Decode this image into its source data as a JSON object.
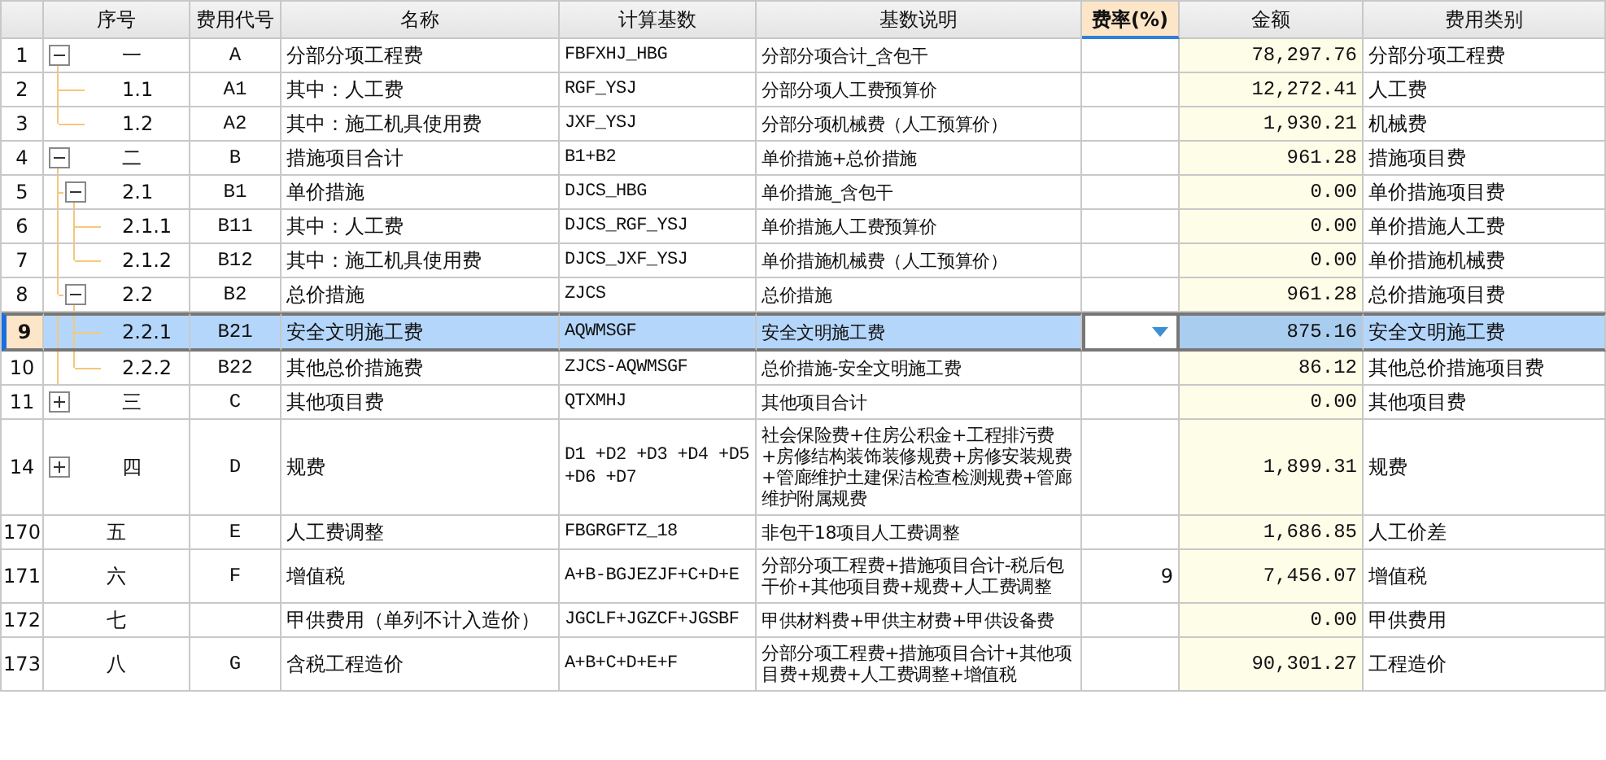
{
  "columns": [
    {
      "label": "序号",
      "kind": "tree",
      "selected": false
    },
    {
      "label": "费用代号",
      "kind": "code",
      "selected": false
    },
    {
      "label": "名称",
      "kind": "text",
      "selected": false
    },
    {
      "label": "计算基数",
      "kind": "formula",
      "selected": false
    },
    {
      "label": "基数说明",
      "kind": "text",
      "selected": false
    },
    {
      "label": "费率(%)",
      "kind": "rate",
      "selected": true
    },
    {
      "label": "金额",
      "kind": "amount",
      "selected": false
    },
    {
      "label": "费用类别",
      "kind": "text",
      "selected": false
    }
  ],
  "rows": [
    {
      "row_num": "1",
      "seq": "一",
      "code": "A",
      "name": "分部分项工程费",
      "base": "FBFXHJ_HBG",
      "base_desc": "分部分项合计_含包干",
      "amount": "78,297.76",
      "category": "分部分项工程费",
      "selected": false,
      "expanded": true,
      "children": [
        {
          "row_num": "2",
          "seq": "1.1",
          "code": "A1",
          "name": "其中：人工费",
          "base": "RGF_YSJ",
          "base_desc": "分部分项人工费预算价",
          "amount": "12,272.41",
          "category": "人工费",
          "selected": false
        },
        {
          "row_num": "3",
          "seq": "1.2",
          "code": "A2",
          "name": "其中：施工机具使用费",
          "base": "JXF_YSJ",
          "base_desc": "分部分项机械费（人工预算价）",
          "amount": "1,930.21",
          "category": "机械费",
          "selected": false
        }
      ]
    },
    {
      "row_num": "4",
      "seq": "二",
      "code": "B",
      "name": "措施项目合计",
      "base": "B1+B2",
      "base_desc": "单价措施+总价措施",
      "amount": "961.28",
      "category": "措施项目费",
      "selected": false,
      "expanded": true,
      "children": [
        {
          "row_num": "5",
          "seq": "2.1",
          "code": "B1",
          "name": "单价措施",
          "base": "DJCS_HBG",
          "base_desc": "单价措施_含包干",
          "amount": "0.00",
          "category": "单价措施项目费",
          "selected": false,
          "expanded": true,
          "children": [
            {
              "row_num": "6",
              "seq": "2.1.1",
              "code": "B11",
              "name": "其中：人工费",
              "base": "DJCS_RGF_YSJ",
              "base_desc": "单价措施人工费预算价",
              "amount": "0.00",
              "category": "单价措施人工费",
              "selected": false
            },
            {
              "row_num": "7",
              "seq": "2.1.2",
              "code": "B12",
              "name": "其中：施工机具使用费",
              "base": "DJCS_JXF_YSJ",
              "base_desc": "单价措施机械费（人工预算价）",
              "amount": "0.00",
              "category": "单价措施机械费",
              "selected": false
            }
          ]
        },
        {
          "row_num": "8",
          "seq": "2.2",
          "code": "B2",
          "name": "总价措施",
          "base": "ZJCS",
          "base_desc": "总价措施",
          "amount": "961.28",
          "category": "总价措施项目费",
          "selected": false,
          "expanded": true,
          "children": [
            {
              "row_num": "9",
              "seq": "2.2.1",
              "code": "B21",
              "name": "安全文明施工费",
              "base": "AQWMSGF",
              "base_desc": "安全文明施工费",
              "amount": "875.16",
              "category": "安全文明施工费",
              "selected": true
            },
            {
              "row_num": "10",
              "seq": "2.2.2",
              "code": "B22",
              "name": "其他总价措施费",
              "base": "ZJCS-AQWMSGF",
              "base_desc": "总价措施-安全文明施工费",
              "amount": "86.12",
              "category": "其他总价措施项目费",
              "selected": false
            }
          ]
        }
      ]
    },
    {
      "row_num": "11",
      "seq": "三",
      "code": "C",
      "name": "其他项目费",
      "base": "QTXMHJ",
      "base_desc": "其他项目合计",
      "amount": "0.00",
      "category": "其他项目费",
      "selected": false,
      "expanded": false
    },
    {
      "row_num": "14",
      "seq": "四",
      "code": "D",
      "name": "规费",
      "base": "D1 +D2 +D3 +D4 +D5 +D6 +D7",
      "base_desc": "社会保险费+住房公积金+工程排污费+房修结构装饰装修规费+房修安装规费+管廊维护土建保洁检查检测规费+管廊维护附属规费",
      "amount": "1,899.31",
      "category": "规费",
      "selected": false,
      "expanded": false
    },
    {
      "row_num": "170",
      "seq": "五",
      "code": "E",
      "name": "人工费调整",
      "base": "FBGRGFTZ_18",
      "base_desc": "非包干18项目人工费调整",
      "amount": "1,686.85",
      "category": "人工价差",
      "selected": false
    },
    {
      "row_num": "171",
      "seq": "六",
      "code": "F",
      "name": "增值税",
      "base": "A+B-BGJEZJF+C+D+E",
      "base_desc": "分部分项工程费+措施项目合计-税后包干价+其他项目费+规费+人工费调整",
      "rate": "9",
      "amount": "7,456.07",
      "category": "增值税",
      "selected": false
    },
    {
      "row_num": "172",
      "seq": "七",
      "name": "甲供费用（单列不计入造价）",
      "base": "JGCLF+JGZCF+JGSBF",
      "base_desc": "甲供材料费+甲供主材费+甲供设备费",
      "amount": "0.00",
      "category": "甲供费用",
      "selected": false
    },
    {
      "row_num": "173",
      "seq": "八",
      "code": "G",
      "name": "含税工程造价",
      "base": "A+B+C+D+E+F",
      "base_desc": "分部分项工程费+措施项目合计+其他项目费+规费+人工费调整+增值税",
      "amount": "90,301.27",
      "category": "工程造价",
      "selected": false
    }
  ]
}
